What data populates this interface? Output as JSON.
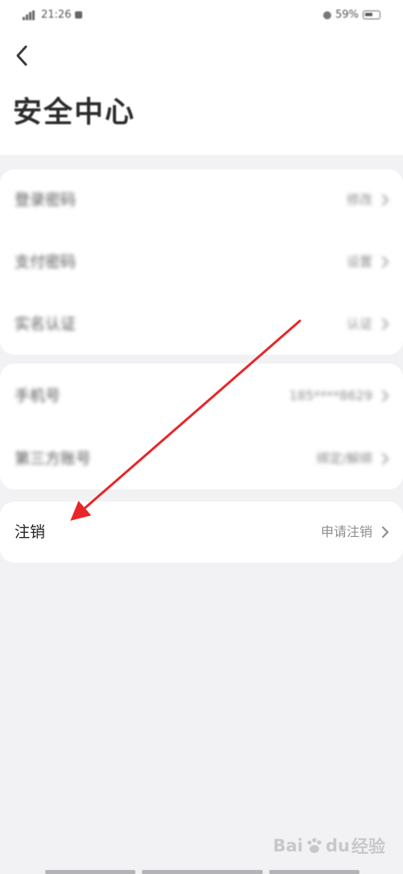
{
  "status_bar": {
    "time": "21:26",
    "battery_percent": "59%"
  },
  "header": {
    "title": "安全中心"
  },
  "groups": [
    {
      "rows": [
        {
          "label": "登录密码",
          "value": "修改"
        },
        {
          "label": "支付密码",
          "value": "设置"
        },
        {
          "label": "实名认证",
          "value": "认证"
        }
      ]
    },
    {
      "rows": [
        {
          "label": "手机号",
          "value": "185****8629"
        },
        {
          "label": "第三方账号",
          "value": "绑定/解绑"
        }
      ]
    },
    {
      "rows": [
        {
          "label": "注销",
          "value": "申请注销"
        }
      ]
    }
  ],
  "annotation": {
    "arrow_color": "#e8262a",
    "target": "注销"
  },
  "watermark": {
    "text_bai": "Bai",
    "text_du": "du",
    "text_jingyan": "经验"
  },
  "colors": {
    "background": "#f2f2f4",
    "card": "#ffffff",
    "value_text": "#8c8c8c"
  }
}
